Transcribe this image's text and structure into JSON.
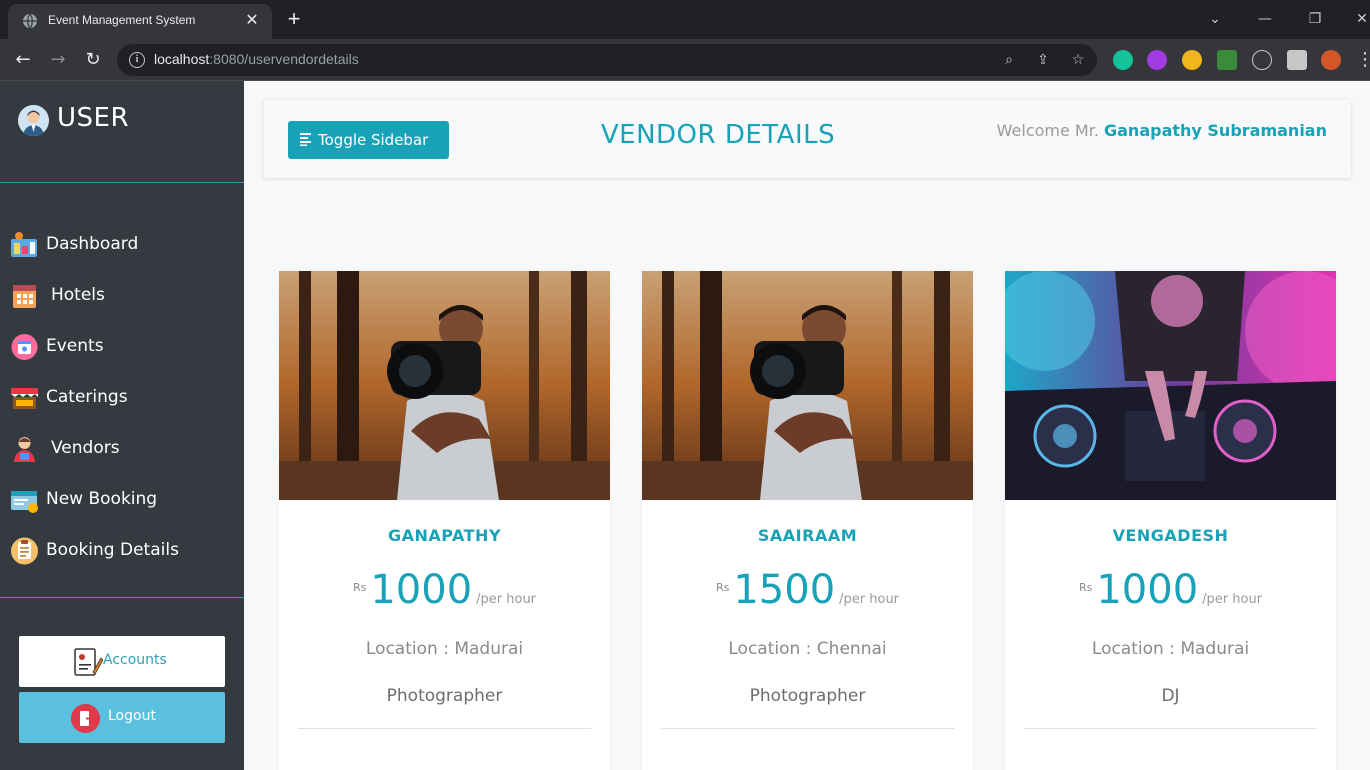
{
  "browser": {
    "tab_title": "Event Management System",
    "tab_close": "✕",
    "new_tab": "+",
    "url_host": "localhost",
    "url_path": ":8080/uservendordetails"
  },
  "sidebar": {
    "title": "USER",
    "items": [
      {
        "label": "Dashboard",
        "icon": "dashboard-icon"
      },
      {
        "label": "Hotels",
        "icon": "hotel-icon"
      },
      {
        "label": "Events",
        "icon": "events-icon"
      },
      {
        "label": "Caterings",
        "icon": "catering-icon"
      },
      {
        "label": "Vendors",
        "icon": "vendor-icon"
      },
      {
        "label": "New Booking",
        "icon": "new-booking-icon"
      },
      {
        "label": "Booking Details",
        "icon": "booking-details-icon"
      }
    ],
    "accounts_label": "Accounts",
    "logout_label": "Logout"
  },
  "header": {
    "toggle_label": "Toggle Sidebar",
    "title": "VENDOR DETAILS",
    "welcome_prefix": "Welcome Mr. ",
    "user_name": "Ganapathy Subramanian"
  },
  "vendors": [
    {
      "name": "GANAPATHY",
      "currency": "Rs",
      "price": "1000",
      "unit": "/per hour",
      "location": "Location : Madurai",
      "role": "Photographer",
      "photo": "photographer-photo"
    },
    {
      "name": "SAAIRAAM",
      "currency": "Rs",
      "price": "1500",
      "unit": "/per hour",
      "location": "Location : Chennai",
      "role": "Photographer",
      "photo": "photographer-photo"
    },
    {
      "name": "VENGADESH",
      "currency": "Rs",
      "price": "1000",
      "unit": "/per hour",
      "location": "Location : Madurai",
      "role": "DJ",
      "photo": "dj-photo"
    }
  ],
  "colors": {
    "accent": "#17a2b8",
    "sidebar_bg": "#343a40",
    "logout_bg": "#5bc0de"
  }
}
